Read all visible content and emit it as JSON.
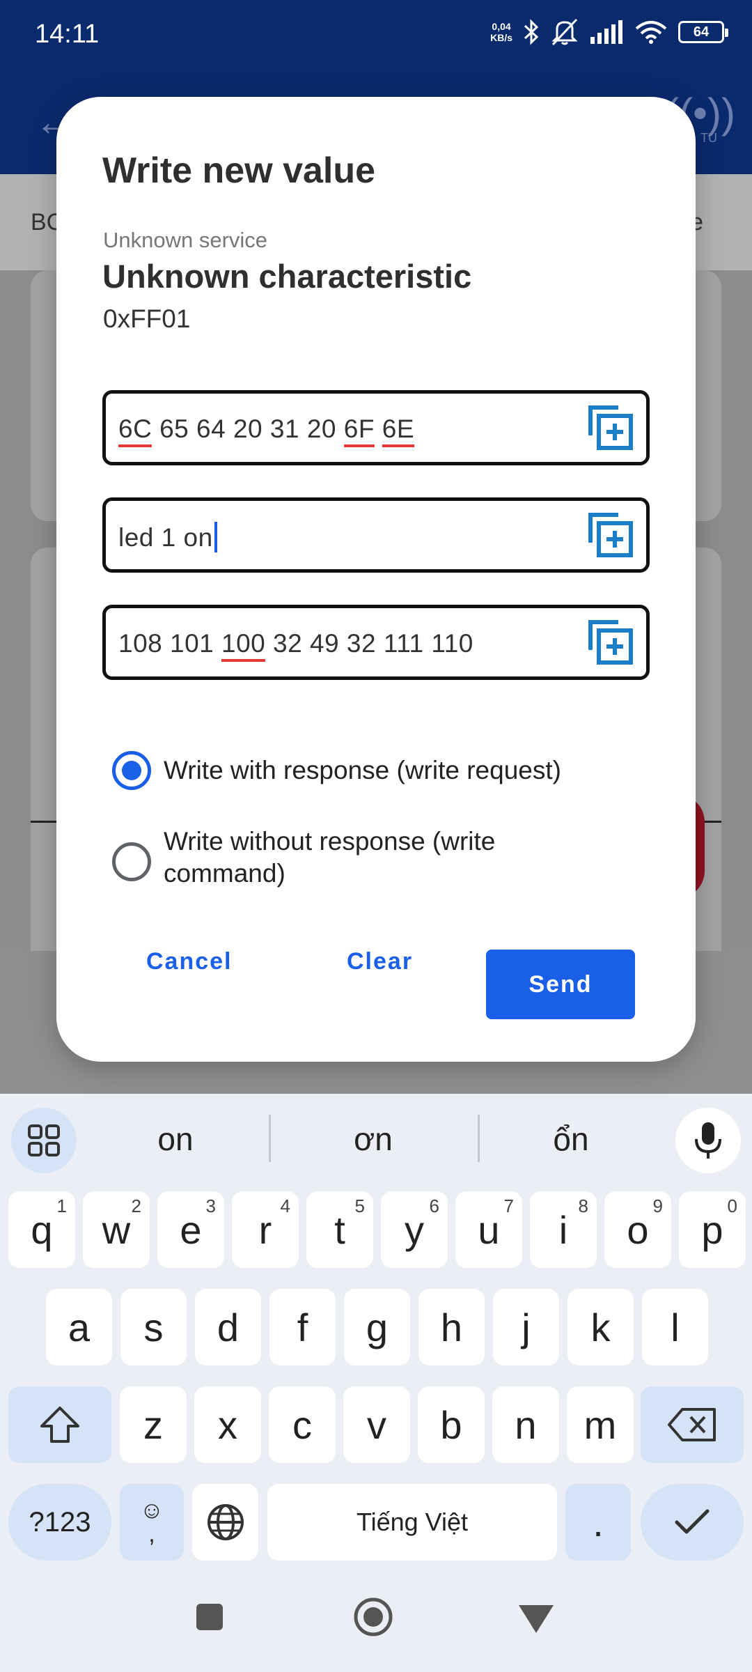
{
  "status_bar": {
    "time": "14:11",
    "net_speed_value": "0,04",
    "net_speed_unit": "KB/s",
    "battery": "64"
  },
  "background": {
    "app_bar_label": "TU",
    "tab_left": "BC",
    "tab_right": "e"
  },
  "dialog": {
    "title": "Write new value",
    "service": "Unknown service",
    "characteristic": "Unknown characteristic",
    "uuid": "0xFF01",
    "fields": {
      "hex": {
        "tokens": [
          "6C",
          "65",
          "64",
          "20",
          "31",
          "20",
          "6F",
          "6E"
        ]
      },
      "text": {
        "value": "led 1 on"
      },
      "decimal": {
        "tokens": [
          "108",
          "101",
          "100",
          "32",
          "49",
          "32",
          "111",
          "110"
        ]
      }
    },
    "write_options": [
      {
        "label": "Write with response (write request)",
        "selected": true
      },
      {
        "label": "Write without response (write command)",
        "selected": false
      }
    ],
    "buttons": {
      "cancel": "Cancel",
      "clear": "Clear",
      "send": "Send"
    },
    "accent_color": "#1a5fe8"
  },
  "keyboard": {
    "suggestions": [
      "on",
      "ơn",
      "ổn"
    ],
    "row1": [
      {
        "key": "q",
        "hint": "1"
      },
      {
        "key": "w",
        "hint": "2"
      },
      {
        "key": "e",
        "hint": "3"
      },
      {
        "key": "r",
        "hint": "4"
      },
      {
        "key": "t",
        "hint": "5"
      },
      {
        "key": "y",
        "hint": "6"
      },
      {
        "key": "u",
        "hint": "7"
      },
      {
        "key": "i",
        "hint": "8"
      },
      {
        "key": "o",
        "hint": "9"
      },
      {
        "key": "p",
        "hint": "0"
      }
    ],
    "row2": [
      "a",
      "s",
      "d",
      "f",
      "g",
      "h",
      "j",
      "k",
      "l"
    ],
    "row3": [
      "z",
      "x",
      "c",
      "v",
      "b",
      "n",
      "m"
    ],
    "symbols_key": "?123",
    "emoji_key_top": "☺",
    "emoji_key_bottom": ",",
    "space_label": "Tiếng Việt",
    "period_key": "."
  }
}
